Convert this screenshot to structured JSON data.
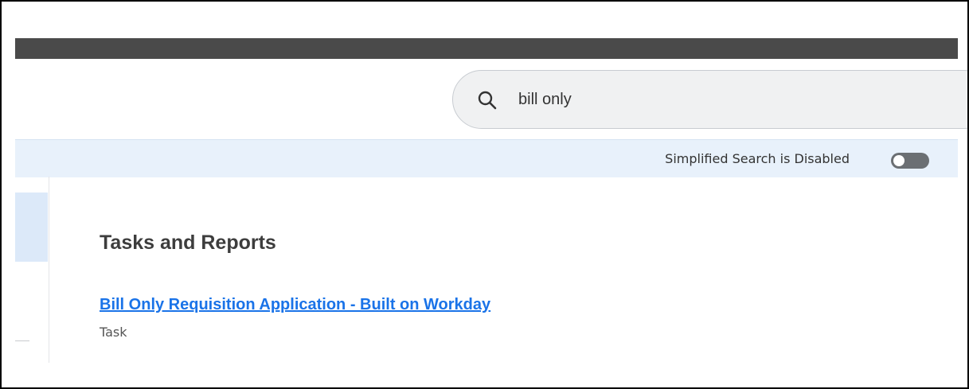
{
  "search": {
    "value": "bill only",
    "icon": "search-icon"
  },
  "info_bar": {
    "text": "Simplified Search is Disabled",
    "toggle_state": "off"
  },
  "results": {
    "section_title": "Tasks and Reports",
    "items": [
      {
        "title": "Bill Only Requisition Application - Built on Workday",
        "type": "Task"
      }
    ]
  },
  "colors": {
    "top_bar": "#4a4a4a",
    "info_bar_bg": "#e8f1fb",
    "link": "#1a73e8",
    "toggle_off": "#6b6f73"
  }
}
